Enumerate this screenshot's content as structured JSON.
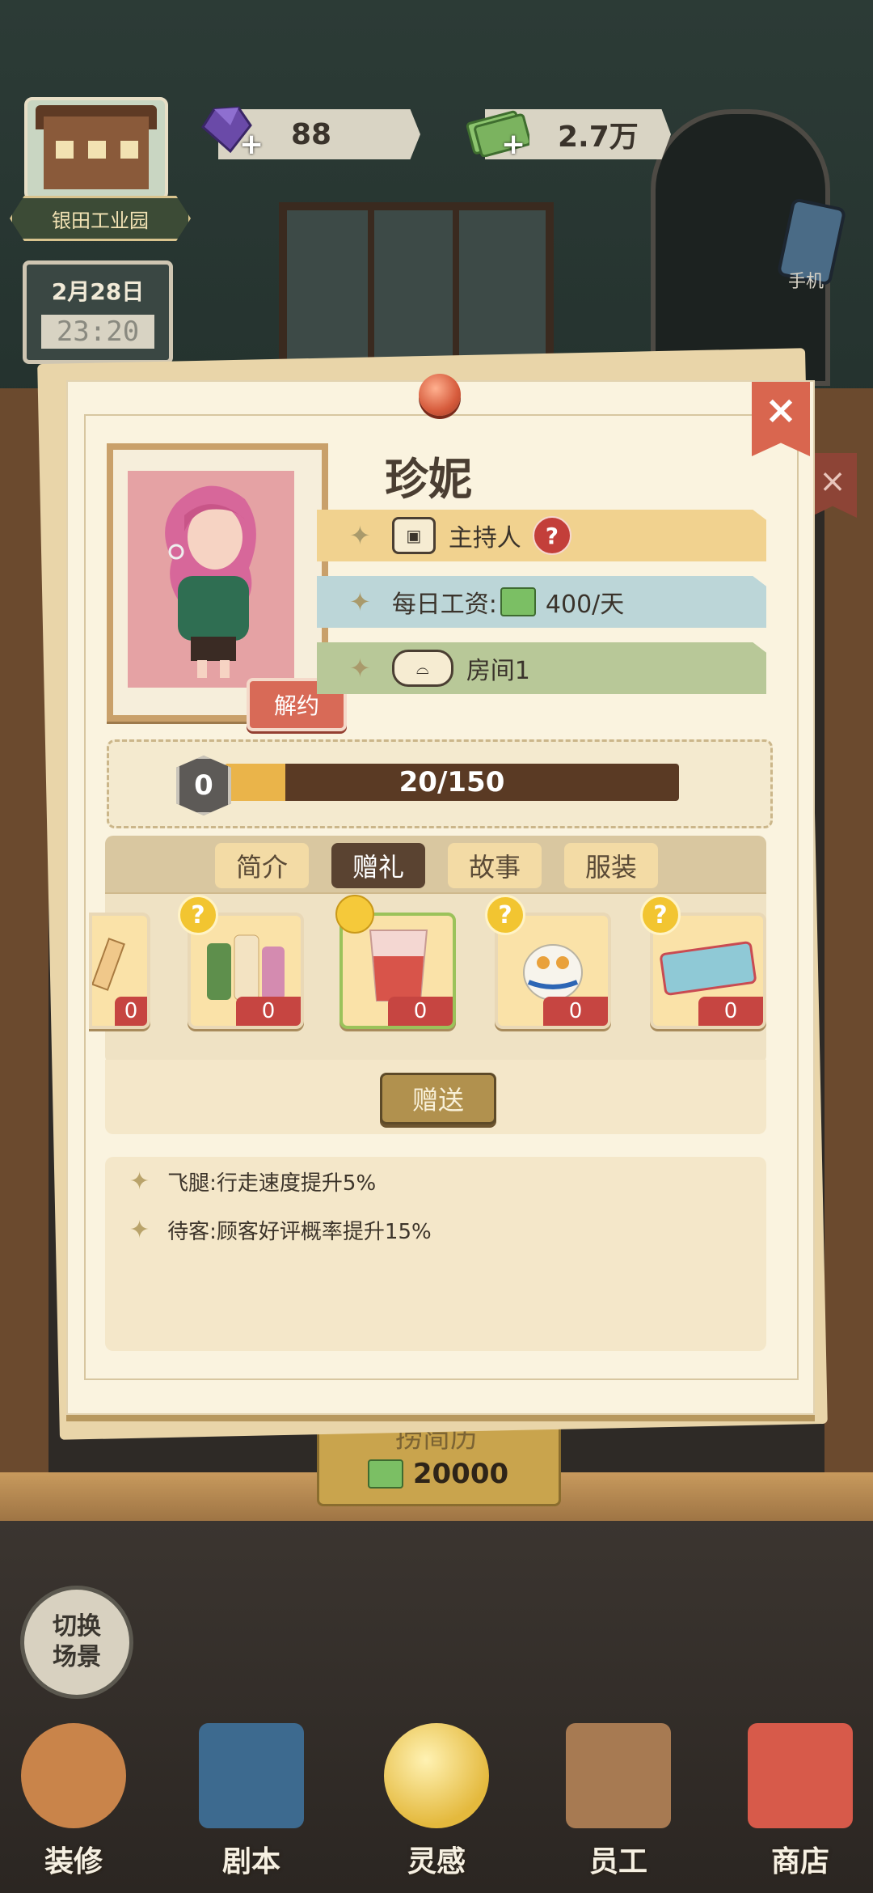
{
  "hud": {
    "location": "银田工业园",
    "date": "2月28日",
    "time": "23:20",
    "gems": "88",
    "cash": "2.7万",
    "plus": "+",
    "phone_label": "手机"
  },
  "profile": {
    "name": "珍妮",
    "role": "主持人",
    "help": "?",
    "wage_label": "每日工资:",
    "wage_value": "400/天",
    "room": "房间1",
    "unbind": "解约",
    "close": "×",
    "level": "0",
    "exp_text": "20/150",
    "exp_fraction": 0.133
  },
  "tabs": [
    {
      "label": "简介",
      "active": false
    },
    {
      "label": "赠礼",
      "active": true
    },
    {
      "label": "故事",
      "active": false
    },
    {
      "label": "服装",
      "active": false
    }
  ],
  "gifts": [
    {
      "name": "partial-gift",
      "count": "0",
      "badge": ""
    },
    {
      "name": "shampoo-set",
      "count": "0",
      "badge": "?"
    },
    {
      "name": "fruit-drink",
      "count": "0",
      "badge": "smile"
    },
    {
      "name": "plush-bird",
      "count": "0",
      "badge": "?"
    },
    {
      "name": "ticket",
      "count": "0",
      "badge": "?"
    }
  ],
  "gift_button": "赠送",
  "traits": [
    "飞腿:行走速度提升5%",
    "待客:顾客好评概率提升15%"
  ],
  "behind": {
    "hire_title": "捞简历",
    "hire_cost": "20000",
    "switch_scene": "切换场景"
  },
  "nav": [
    {
      "label": "装修",
      "icon": "house-icon"
    },
    {
      "label": "剧本",
      "icon": "script-book-icon"
    },
    {
      "label": "灵感",
      "icon": "bulb-icon"
    },
    {
      "label": "员工",
      "icon": "staff-card-icon"
    },
    {
      "label": "商店",
      "icon": "shop-icon"
    }
  ],
  "colors": {
    "accent_red": "#d9664f",
    "exp_fill": "#eab44a",
    "tab_active": "#5a4331"
  }
}
